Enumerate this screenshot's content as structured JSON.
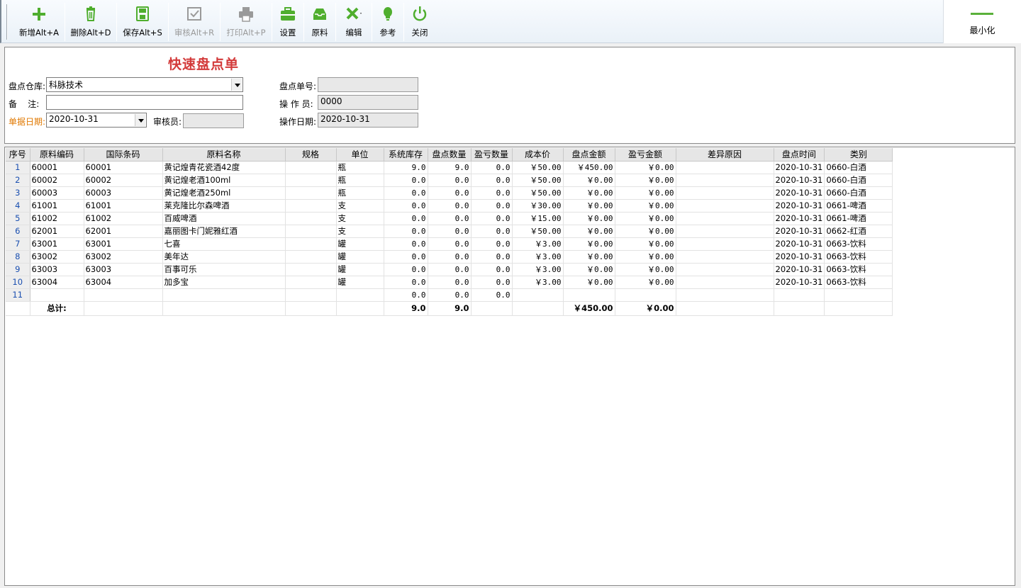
{
  "toolbar": {
    "buttons": [
      {
        "label": "新增Alt+A",
        "icon": "plus-icon",
        "enabled": true
      },
      {
        "label": "删除Alt+D",
        "icon": "trash-icon",
        "enabled": true
      },
      {
        "label": "保存Alt+S",
        "icon": "save-icon",
        "enabled": true
      },
      {
        "label": "审核Alt+R",
        "icon": "audit-icon",
        "enabled": false
      },
      {
        "label": "打印Alt+P",
        "icon": "printer-icon",
        "enabled": false
      },
      {
        "label": "设置",
        "icon": "toolbox-icon",
        "enabled": true
      },
      {
        "label": "原料",
        "icon": "tray-icon",
        "enabled": true
      },
      {
        "label": "编辑",
        "icon": "tools-icon",
        "enabled": true
      },
      {
        "label": "参考",
        "icon": "lightbulb-icon",
        "enabled": true
      },
      {
        "label": "关闭",
        "icon": "power-icon",
        "enabled": true
      }
    ],
    "minimize_label": "最小化",
    "accent_color": "#5ab13a"
  },
  "form": {
    "title": "快速盘点单",
    "warehouse_label": "盘点仓库:",
    "warehouse_value": "科脉技术",
    "remark_label": "备    注:",
    "remark_value": "",
    "doc_date_label": "单据日期:",
    "doc_date_value": "2020-10-31",
    "auditor_label": "审核员:",
    "auditor_value": "",
    "doc_no_label": "盘点单号:",
    "doc_no_value": "",
    "operator_label": "操 作 员:",
    "operator_value": "0000",
    "op_date_label": "操作日期:",
    "op_date_value": "2020-10-31"
  },
  "grid": {
    "columns": [
      "序号",
      "原料编码",
      "国际条码",
      "原料名称",
      "规格",
      "单位",
      "系统库存",
      "盘点数量",
      "盈亏数量",
      "成本价",
      "盘点金额",
      "盈亏金额",
      "差异原因",
      "盘点时间",
      "类别"
    ],
    "rows": [
      [
        "1",
        "60001",
        "60001",
        "黄记煌青花瓷酒42度",
        "",
        "瓶",
        "9.0",
        "9.0",
        "0.0",
        "￥50.00",
        "￥450.00",
        "￥0.00",
        "",
        "2020-10-31",
        "0660-白酒"
      ],
      [
        "2",
        "60002",
        "60002",
        "黄记煌老酒100ml",
        "",
        "瓶",
        "0.0",
        "0.0",
        "0.0",
        "￥50.00",
        "￥0.00",
        "￥0.00",
        "",
        "2020-10-31",
        "0660-白酒"
      ],
      [
        "3",
        "60003",
        "60003",
        "黄记煌老酒250ml",
        "",
        "瓶",
        "0.0",
        "0.0",
        "0.0",
        "￥50.00",
        "￥0.00",
        "￥0.00",
        "",
        "2020-10-31",
        "0660-白酒"
      ],
      [
        "4",
        "61001",
        "61001",
        "莱克隆比尔森啤酒",
        "",
        "支",
        "0.0",
        "0.0",
        "0.0",
        "￥30.00",
        "￥0.00",
        "￥0.00",
        "",
        "2020-10-31",
        "0661-啤酒"
      ],
      [
        "5",
        "61002",
        "61002",
        "百威啤酒",
        "",
        "支",
        "0.0",
        "0.0",
        "0.0",
        "￥15.00",
        "￥0.00",
        "￥0.00",
        "",
        "2020-10-31",
        "0661-啤酒"
      ],
      [
        "6",
        "62001",
        "62001",
        "嘉丽图卡门妮雅红酒",
        "",
        "支",
        "0.0",
        "0.0",
        "0.0",
        "￥50.00",
        "￥0.00",
        "￥0.00",
        "",
        "2020-10-31",
        "0662-红酒"
      ],
      [
        "7",
        "63001",
        "63001",
        "七喜",
        "",
        "罐",
        "0.0",
        "0.0",
        "0.0",
        "￥3.00",
        "￥0.00",
        "￥0.00",
        "",
        "2020-10-31",
        "0663-饮料"
      ],
      [
        "8",
        "63002",
        "63002",
        "美年达",
        "",
        "罐",
        "0.0",
        "0.0",
        "0.0",
        "￥3.00",
        "￥0.00",
        "￥0.00",
        "",
        "2020-10-31",
        "0663-饮料"
      ],
      [
        "9",
        "63003",
        "63003",
        "百事可乐",
        "",
        "罐",
        "0.0",
        "0.0",
        "0.0",
        "￥3.00",
        "￥0.00",
        "￥0.00",
        "",
        "2020-10-31",
        "0663-饮料"
      ],
      [
        "10",
        "63004",
        "63004",
        "加多宝",
        "",
        "罐",
        "0.0",
        "0.0",
        "0.0",
        "￥3.00",
        "￥0.00",
        "￥0.00",
        "",
        "2020-10-31",
        "0663-饮料"
      ],
      [
        "11",
        "",
        "",
        "",
        "",
        "",
        "0.0",
        "0.0",
        "0.0",
        "",
        "",
        "",
        "",
        "",
        ""
      ]
    ],
    "total_row": [
      "",
      "总计:",
      "",
      "",
      "",
      "",
      "9.0",
      "9.0",
      "",
      "",
      "￥450.00",
      "￥0.00",
      "",
      "",
      ""
    ]
  }
}
